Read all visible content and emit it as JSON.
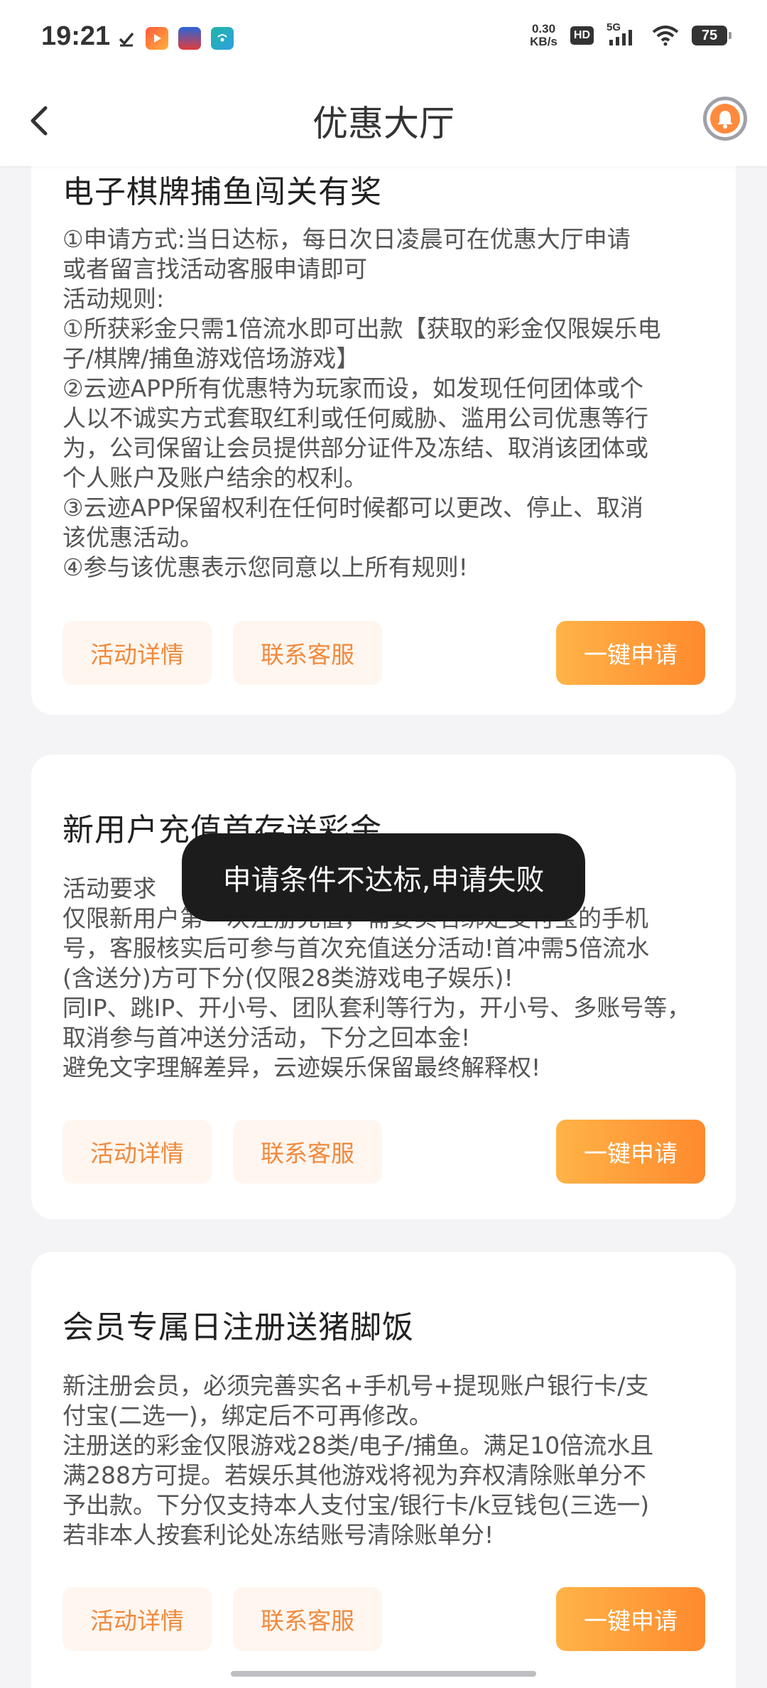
{
  "status_bar": {
    "time": "19:21",
    "net_speed_value": "0.30",
    "net_speed_unit": "KB/s",
    "hd_label": "HD",
    "signal_label": "5G",
    "battery": "75",
    "icons": [
      "check-icon",
      "video-app-icon",
      "boss-app-icon",
      "wifi-app-icon",
      "signal-icon",
      "wifi-icon"
    ]
  },
  "header": {
    "title": "优惠大厅"
  },
  "cards": [
    {
      "title": "电子棋牌捕鱼闯关有奖",
      "description": "①申请方式:当日达标，每日次日凌晨可在优惠大厅申请\n或者留言找活动客服申请即可\n活动规则:\n①所获彩金只需1倍流水即可出款【获取的彩金仅限娱乐电\n子/棋牌/捕鱼游戏倍场游戏】\n②云迹APP所有优惠特为玩家而设，如发现任何团体或个\n人以不诚实方式套取红利或任何威胁、滥用公司优惠等行\n为，公司保留让会员提供部分证件及冻结、取消该团体或\n个人账户及账户结余的权利。\n③云迹APP保留权利在任何时候都可以更改、停止、取消\n该优惠活动。\n④参与该优惠表示您同意以上所有规则!",
      "details_label": "活动详情",
      "service_label": "联系客服",
      "apply_label": "一键申请"
    },
    {
      "title": "新用户充值首存送彩金",
      "description": "活动要求\n仅限新用户第一次注册充值，需要实名绑定支付宝的手机\n号，客服核实后可参与首次充值送分活动!首冲需5倍流水\n(含送分)方可下分(仅限28类游戏电子娱乐)!\n同IP、跳IP、开小号、团队套利等行为，开小号、多账号等，\n取消参与首冲送分活动，下分之回本金!\n避免文字理解差异，云迹娱乐保留最终解释权!",
      "details_label": "活动详情",
      "service_label": "联系客服",
      "apply_label": "一键申请"
    },
    {
      "title": "会员专属日注册送猪脚饭",
      "description": "新注册会员，必须完善实名+手机号+提现账户银行卡/支\n付宝(二选一)，绑定后不可再修改。\n注册送的彩金仅限游戏28类/电子/捕鱼。满足10倍流水且\n满288方可提。若娱乐其他游戏将视为弃权清除账单分不\n予出款。下分仅支持本人支付宝/银行卡/k豆钱包(三选一)\n若非本人按套利论处冻结账号清除账单分!",
      "details_label": "活动详情",
      "service_label": "联系客服",
      "apply_label": "一键申请"
    }
  ],
  "toast": {
    "message": "申请条件不达标,申请失败"
  },
  "colors": {
    "accent": "#ff8a2e",
    "accent_light": "#fff6f0",
    "background": "#f4f4f6"
  }
}
